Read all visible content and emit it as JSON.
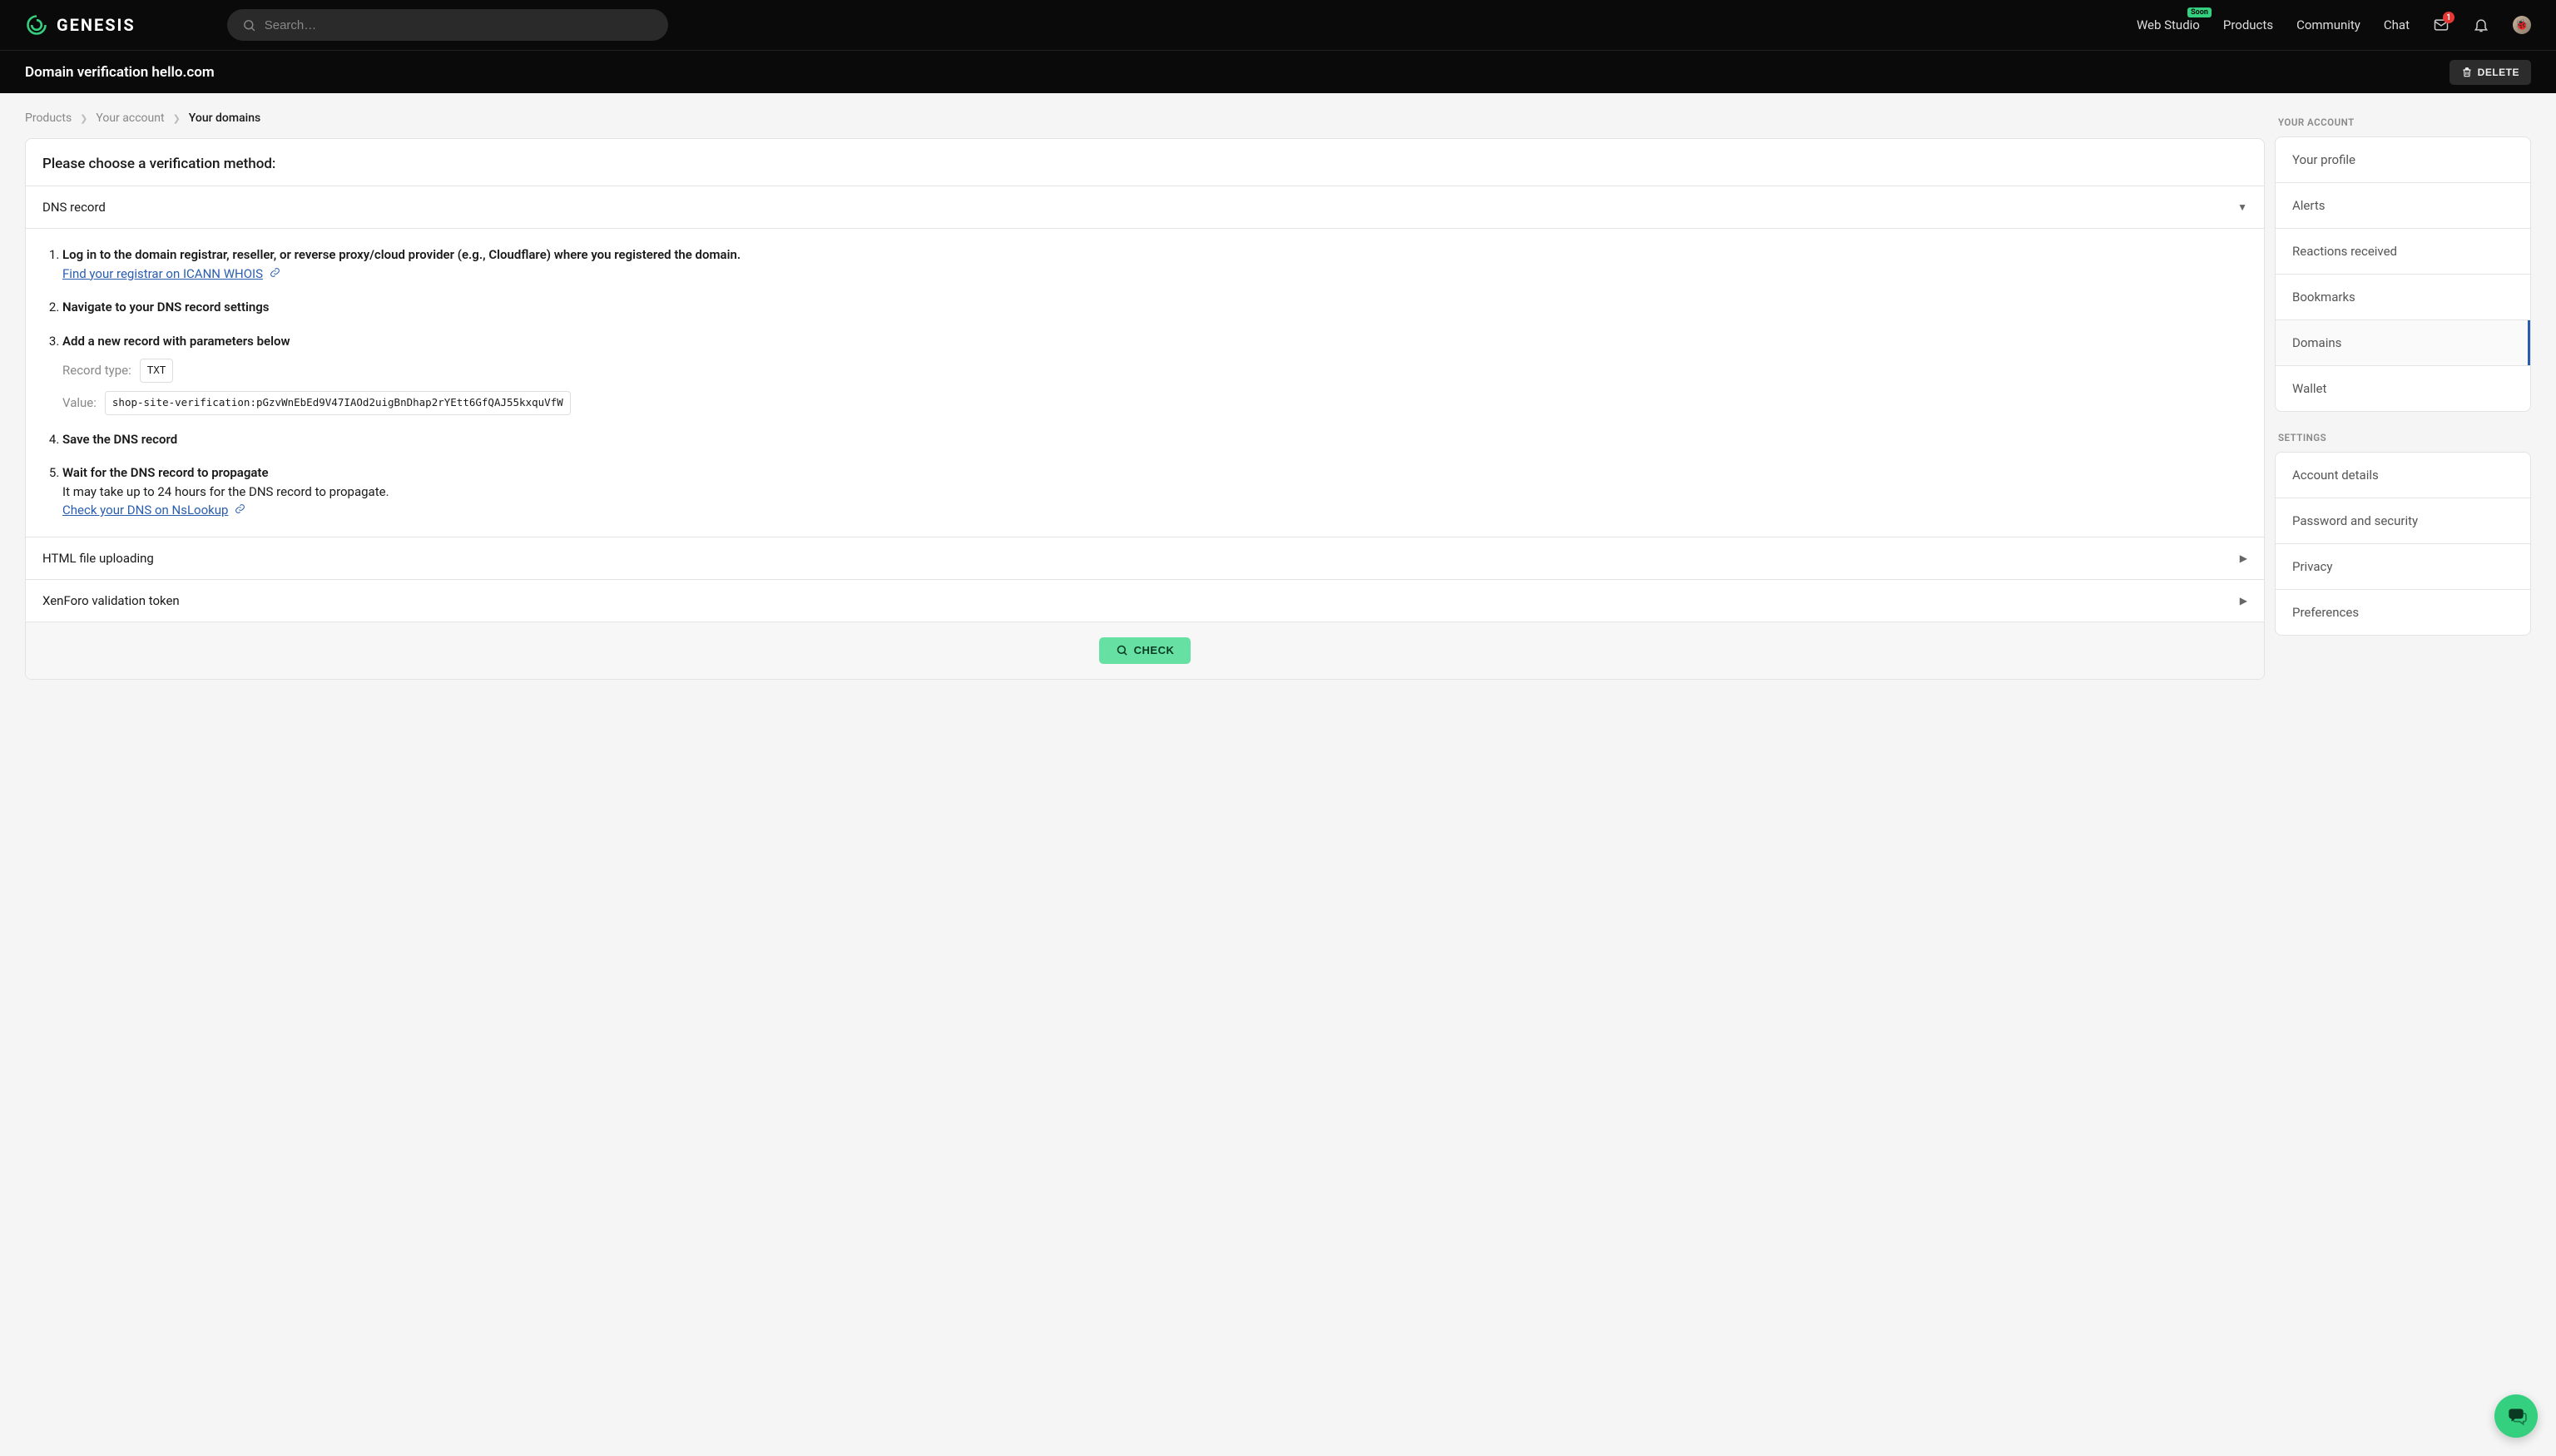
{
  "brand": "GENESIS",
  "search": {
    "placeholder": "Search…"
  },
  "topnav": {
    "web_studio": "Web Studio",
    "web_studio_badge": "Soon",
    "products": "Products",
    "community": "Community",
    "chat": "Chat",
    "mail_count": "1"
  },
  "subhead": {
    "title": "Domain verification hello.com",
    "delete": "DELETE"
  },
  "breadcrumb": {
    "a": "Products",
    "b": "Your account",
    "c": "Your domains"
  },
  "panel": {
    "choose": "Please choose a verification method:",
    "method_dns": "DNS record",
    "method_html": "HTML file uploading",
    "method_token": "XenForo validation token",
    "steps": {
      "s1_title": "Log in to the domain registrar, reseller, or reverse proxy/cloud provider (e.g., Cloudflare) where you registered the domain.",
      "s1_link": "Find your registrar on ICANN WHOIS",
      "s2_title": "Navigate to your DNS record settings",
      "s3_title": "Add a new record with parameters below",
      "record_type_label": "Record type:",
      "record_type_value": "TXT",
      "value_label": "Value:",
      "value_value": "shop-site-verification:pGzvWnEbEd9V47IAOd2uigBnDhap2rYEtt6GfQAJ55kxquVfW",
      "s4_title": "Save the DNS record",
      "s5_title": "Wait for the DNS record to propagate",
      "s5_desc": "It may take up to 24 hours for the DNS record to propagate.",
      "s5_link": "Check your DNS on NsLookup"
    },
    "check": "CHECK"
  },
  "sidebar": {
    "heading_account": "YOUR ACCOUNT",
    "account_items": [
      "Your profile",
      "Alerts",
      "Reactions received",
      "Bookmarks",
      "Domains",
      "Wallet"
    ],
    "account_active_index": 4,
    "heading_settings": "SETTINGS",
    "settings_items": [
      "Account details",
      "Password and security",
      "Privacy",
      "Preferences"
    ]
  }
}
